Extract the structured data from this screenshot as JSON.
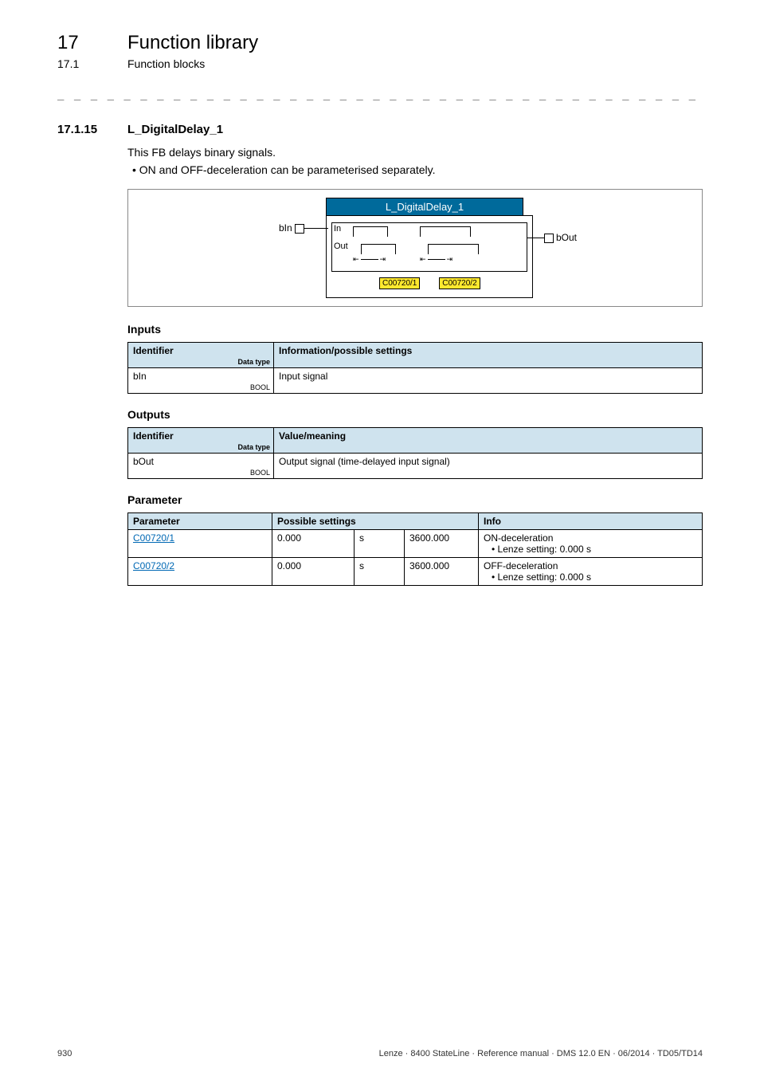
{
  "header": {
    "chapter_number": "17",
    "chapter_title": "Function library",
    "section_number": "17.1",
    "section_title": "Function blocks",
    "dashes": "_ _ _ _ _ _ _ _ _ _ _ _ _ _ _ _ _ _ _ _ _ _ _ _ _ _ _ _ _ _ _ _ _ _ _ _ _ _ _ _ _ _ _ _ _ _ _ _ _ _ _ _ _ _ _ _ _ _ _ _ _ _ _ _"
  },
  "subsection": {
    "number": "17.1.15",
    "title": "L_DigitalDelay_1",
    "intro": "This FB delays binary signals.",
    "bullet": "• ON and OFF-deceleration can be parameterised separately."
  },
  "diagram": {
    "title": "L_DigitalDelay_1",
    "port_in": "bIn",
    "port_out": "bOut",
    "label_in": "In",
    "label_out": "Out",
    "code1": "C00720/1",
    "code2": "C00720/2"
  },
  "inputs_section": {
    "heading": "Inputs",
    "col_identifier": "Identifier",
    "col_datatype": "Data type",
    "col_info": "Information/possible settings",
    "rows": [
      {
        "id": "bIn",
        "dtype": "BOOL",
        "info": "Input signal"
      }
    ]
  },
  "outputs_section": {
    "heading": "Outputs",
    "col_identifier": "Identifier",
    "col_datatype": "Data type",
    "col_info": "Value/meaning",
    "rows": [
      {
        "id": "bOut",
        "dtype": "BOOL",
        "info": "Output signal (time-delayed input signal)"
      }
    ]
  },
  "param_section": {
    "heading": "Parameter",
    "col_param": "Parameter",
    "col_settings": "Possible settings",
    "col_info": "Info",
    "rows": [
      {
        "param": "C00720/1",
        "min": "0.000",
        "unit": "s",
        "max": "3600.000",
        "info_line1": "ON-deceleration",
        "info_line2": "• Lenze setting: 0.000 s"
      },
      {
        "param": "C00720/2",
        "min": "0.000",
        "unit": "s",
        "max": "3600.000",
        "info_line1": "OFF-deceleration",
        "info_line2": "• Lenze setting: 0.000 s"
      }
    ]
  },
  "footer": {
    "page_num": "930",
    "doc_ref": "Lenze · 8400 StateLine · Reference manual · DMS 12.0 EN · 06/2014 · TD05/TD14"
  }
}
